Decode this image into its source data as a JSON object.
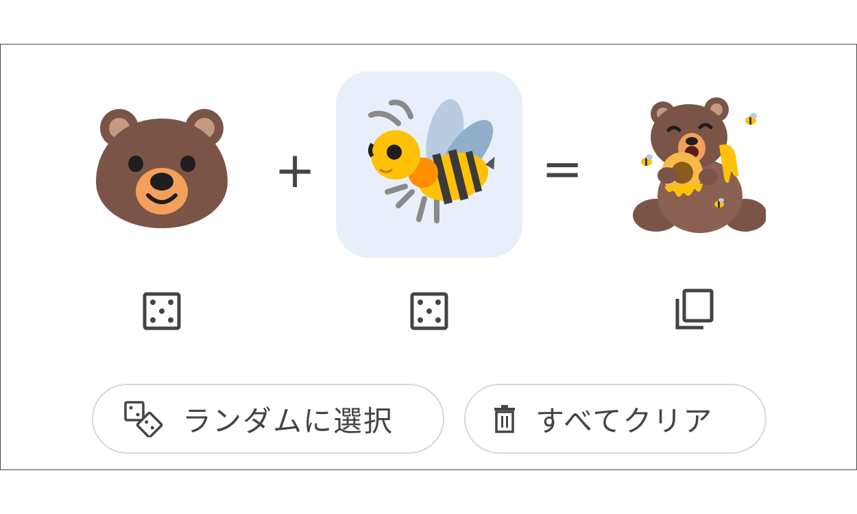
{
  "mixer": {
    "left_emoji": {
      "icon": "bear-face-icon"
    },
    "middle_emoji": {
      "icon": "honeybee-icon",
      "selected": true,
      "highlight_color": "#e8effb"
    },
    "result_emoji": {
      "icon": "bear-with-honey-and-bees-icon"
    },
    "plus_sign": "+",
    "equals_sign": "="
  },
  "controls": {
    "left_randomize_icon": "dice-icon",
    "middle_randomize_icon": "dice-icon",
    "copy_icon": "copy-icon"
  },
  "actions": {
    "random_label": "ランダムに選択",
    "random_icon": "dice-pair-icon",
    "clear_label": "すべてクリア",
    "clear_icon": "trash-icon"
  },
  "colors": {
    "text": "#444444",
    "border": "#d6d6d6",
    "selected_bg": "#e8effb"
  }
}
